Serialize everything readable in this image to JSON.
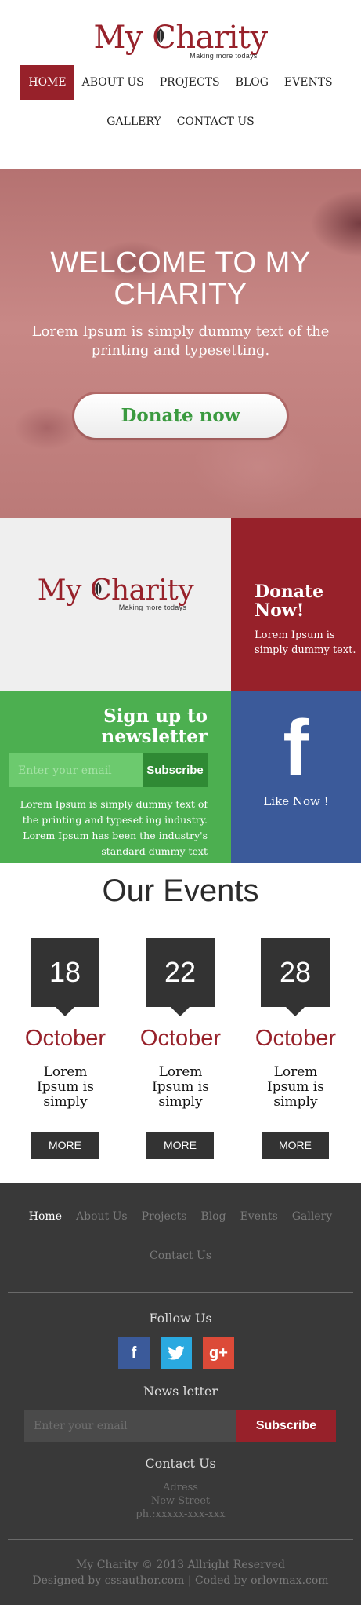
{
  "header": {
    "logo": {
      "text_before": "My ",
      "text_after": "harity",
      "letter_c": "C",
      "tagline": "Making more todays"
    },
    "nav": [
      {
        "label": "HOME",
        "active": true
      },
      {
        "label": "ABOUT US"
      },
      {
        "label": "PROJECTS"
      },
      {
        "label": "BLOG"
      },
      {
        "label": "EVENTS"
      },
      {
        "label": "GALLERY"
      },
      {
        "label": "CONTACT US",
        "underline": true
      }
    ]
  },
  "hero": {
    "title": "WELCOME TO MY CHARITY",
    "subtitle": "Lorem Ipsum is simply dummy text of the printing and typesetting.",
    "donate_label": "Donate now"
  },
  "logo_block": {
    "text_before": "My ",
    "text_after": "harity",
    "letter_c": "C",
    "tagline": "Making more todays"
  },
  "donate_block": {
    "title": "Donate Now!",
    "text": "Lorem Ipsum is simply dummy text."
  },
  "newsletter": {
    "title": "Sign up to newsletter",
    "placeholder": "Enter your email",
    "subscribe_label": "Subscribe",
    "text": "Lorem Ipsum is simply dummy text of the printing and typeset ing industry. Lorem Ipsum has been the industry's standard dummy text"
  },
  "facebook": {
    "icon": "f",
    "label": "Like Now !"
  },
  "events": {
    "title": "Our Events",
    "items": [
      {
        "day": "18",
        "month": "October",
        "text": "Lorem Ipsum is simply",
        "more_label": "MORE"
      },
      {
        "day": "22",
        "month": "October",
        "text": "Lorem Ipsum is simply",
        "more_label": "MORE"
      },
      {
        "day": "28",
        "month": "October",
        "text": "Lorem Ipsum is simply",
        "more_label": "MORE"
      }
    ]
  },
  "footer": {
    "nav": [
      {
        "label": "Home",
        "active": true
      },
      {
        "label": "About Us"
      },
      {
        "label": "Projects"
      },
      {
        "label": "Blog"
      },
      {
        "label": "Events"
      },
      {
        "label": "Gallery"
      },
      {
        "label": "Contact Us"
      }
    ],
    "follow_title": "Follow Us",
    "social": [
      {
        "name": "facebook-icon",
        "glyph": "f",
        "color": "#3b5a9a"
      },
      {
        "name": "twitter-icon",
        "glyph": "t",
        "color": "#2aa9e0"
      },
      {
        "name": "google-plus-icon",
        "glyph": "g+",
        "color": "#dc4a38"
      }
    ],
    "newsletter_title": "News letter",
    "newsletter_placeholder": "Enter your email",
    "subscribe_label": "Subscribe",
    "contact_title": "Contact Us",
    "address": [
      "Adress",
      "New Street",
      "ph.:xxxxx-xxx-xxx"
    ],
    "copyright": "My Charity © 2013 Allright Reserved",
    "credits": "Designed by cssauthor.com | Coded by orlovmax.com"
  },
  "colors": {
    "brand": "#97212a",
    "green": "#4caf50",
    "facebook": "#3b5a9a",
    "dark": "#333333",
    "footer": "#393939"
  }
}
